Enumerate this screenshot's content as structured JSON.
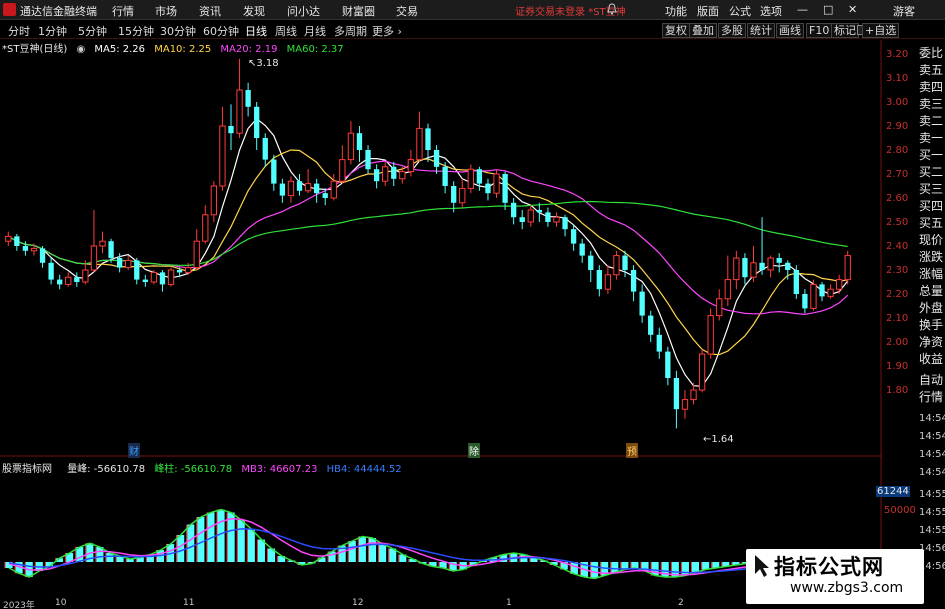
{
  "app": {
    "title": "通达信金融终端",
    "menu": [
      "行情",
      "市场",
      "资讯",
      "发现",
      "问小达",
      "财富圈",
      "交易"
    ],
    "warning": "证券交易未登录",
    "stock_tag": "*ST豆神",
    "links": [
      "功能",
      "版面",
      "公式",
      "选项"
    ],
    "guest": "游客"
  },
  "periods": [
    "分时",
    "1分钟",
    "5分钟",
    "15分钟",
    "30分钟",
    "60分钟",
    "日线",
    "周线",
    "月线",
    "多周期",
    "更多"
  ],
  "active_period": "日线",
  "toolbar_right": [
    "复权",
    "叠加",
    "多股",
    "统计",
    "画线",
    "F10",
    "标记",
    "+自选"
  ],
  "main_legend": {
    "name": "*ST豆神(日线)",
    "ma5": "MA5: 2.26",
    "ma10": "MA10: 2.25",
    "ma20": "MA20: 2.19",
    "ma60": "MA60: 2.37"
  },
  "annotations": {
    "high": "3.18",
    "low": "1.64"
  },
  "event_marks": [
    "财",
    "除",
    "预"
  ],
  "sub_legend": {
    "name": "股票指标网",
    "vol": "量峰: -56610.78",
    "bar": "峰柱: -56610.78",
    "mb3": "MB3: 46607.23",
    "hb4": "HB4: 44444.52"
  },
  "y_axis": [
    "3.20",
    "3.10",
    "3.00",
    "2.90",
    "2.80",
    "2.70",
    "2.60",
    "2.50",
    "2.40",
    "2.30",
    "2.20",
    "2.10",
    "2.00",
    "1.90",
    "1.80"
  ],
  "sub_axis": {
    "value": "61244",
    "mid": "50000"
  },
  "times": [
    "14:54",
    "14:54",
    "14:54",
    "14:54",
    "14:55",
    "14:55",
    "14:55",
    "14:56",
    "14:56"
  ],
  "right_panel": [
    "委比",
    "卖五",
    "卖四",
    "卖三",
    "卖二",
    "卖一",
    "买一",
    "买二",
    "买三",
    "买四",
    "买五",
    "现价",
    "涨跌",
    "涨幅",
    "总量",
    "外盘",
    "换手",
    "净资",
    "收益",
    "自动",
    "行情"
  ],
  "x_axis": [
    "2023年",
    "10",
    "11",
    "12",
    "1",
    "2"
  ],
  "watermark": {
    "title": "指标公式网",
    "url": "www.zbgs3.com"
  },
  "colors": {
    "up": "#ff3b3b",
    "down": "#54ffff",
    "ma5": "#ffffff",
    "ma10": "#ffd54a",
    "ma20": "#ff46ff",
    "ma60": "#2fe23a",
    "axis": "#c83030"
  },
  "chart_data": {
    "type": "candlestick",
    "ylim": [
      1.64,
      3.22
    ],
    "candles": [
      {
        "o": 2.42,
        "c": 2.44,
        "h": 2.46,
        "l": 2.4
      },
      {
        "o": 2.44,
        "c": 2.4,
        "h": 2.45,
        "l": 2.38
      },
      {
        "o": 2.4,
        "c": 2.38,
        "h": 2.42,
        "l": 2.36
      },
      {
        "o": 2.38,
        "c": 2.39,
        "h": 2.41,
        "l": 2.36
      },
      {
        "o": 2.39,
        "c": 2.33,
        "h": 2.4,
        "l": 2.31
      },
      {
        "o": 2.33,
        "c": 2.26,
        "h": 2.35,
        "l": 2.24
      },
      {
        "o": 2.26,
        "c": 2.24,
        "h": 2.28,
        "l": 2.22
      },
      {
        "o": 2.24,
        "c": 2.27,
        "h": 2.29,
        "l": 2.23
      },
      {
        "o": 2.27,
        "c": 2.25,
        "h": 2.29,
        "l": 2.23
      },
      {
        "o": 2.25,
        "c": 2.3,
        "h": 2.34,
        "l": 2.24
      },
      {
        "o": 2.3,
        "c": 2.4,
        "h": 2.55,
        "l": 2.29
      },
      {
        "o": 2.4,
        "c": 2.42,
        "h": 2.46,
        "l": 2.37
      },
      {
        "o": 2.42,
        "c": 2.35,
        "h": 2.43,
        "l": 2.33
      },
      {
        "o": 2.35,
        "c": 2.31,
        "h": 2.37,
        "l": 2.29
      },
      {
        "o": 2.31,
        "c": 2.34,
        "h": 2.36,
        "l": 2.3
      },
      {
        "o": 2.34,
        "c": 2.26,
        "h": 2.35,
        "l": 2.24
      },
      {
        "o": 2.26,
        "c": 2.25,
        "h": 2.28,
        "l": 2.23
      },
      {
        "o": 2.25,
        "c": 2.29,
        "h": 2.3,
        "l": 2.24
      },
      {
        "o": 2.29,
        "c": 2.24,
        "h": 2.3,
        "l": 2.21
      },
      {
        "o": 2.24,
        "c": 2.3,
        "h": 2.31,
        "l": 2.23
      },
      {
        "o": 2.3,
        "c": 2.29,
        "h": 2.31,
        "l": 2.27
      },
      {
        "o": 2.29,
        "c": 2.31,
        "h": 2.33,
        "l": 2.28
      },
      {
        "o": 2.31,
        "c": 2.42,
        "h": 2.47,
        "l": 2.3
      },
      {
        "o": 2.42,
        "c": 2.53,
        "h": 2.57,
        "l": 2.41
      },
      {
        "o": 2.53,
        "c": 2.65,
        "h": 2.67,
        "l": 2.5
      },
      {
        "o": 2.65,
        "c": 2.9,
        "h": 2.98,
        "l": 2.63
      },
      {
        "o": 2.9,
        "c": 2.87,
        "h": 2.99,
        "l": 2.8
      },
      {
        "o": 2.87,
        "c": 3.05,
        "h": 3.18,
        "l": 2.85
      },
      {
        "o": 3.05,
        "c": 2.98,
        "h": 3.08,
        "l": 2.94
      },
      {
        "o": 2.98,
        "c": 2.85,
        "h": 3.0,
        "l": 2.8
      },
      {
        "o": 2.85,
        "c": 2.76,
        "h": 2.87,
        "l": 2.73
      },
      {
        "o": 2.76,
        "c": 2.66,
        "h": 2.78,
        "l": 2.63
      },
      {
        "o": 2.66,
        "c": 2.61,
        "h": 2.68,
        "l": 2.58
      },
      {
        "o": 2.61,
        "c": 2.67,
        "h": 2.69,
        "l": 2.58
      },
      {
        "o": 2.67,
        "c": 2.63,
        "h": 2.7,
        "l": 2.61
      },
      {
        "o": 2.63,
        "c": 2.66,
        "h": 2.72,
        "l": 2.62
      },
      {
        "o": 2.66,
        "c": 2.62,
        "h": 2.68,
        "l": 2.58
      },
      {
        "o": 2.62,
        "c": 2.6,
        "h": 2.64,
        "l": 2.57
      },
      {
        "o": 2.6,
        "c": 2.67,
        "h": 2.7,
        "l": 2.59
      },
      {
        "o": 2.67,
        "c": 2.76,
        "h": 2.82,
        "l": 2.66
      },
      {
        "o": 2.76,
        "c": 2.87,
        "h": 2.92,
        "l": 2.74
      },
      {
        "o": 2.87,
        "c": 2.8,
        "h": 2.9,
        "l": 2.75
      },
      {
        "o": 2.8,
        "c": 2.72,
        "h": 2.82,
        "l": 2.7
      },
      {
        "o": 2.72,
        "c": 2.67,
        "h": 2.74,
        "l": 2.64
      },
      {
        "o": 2.67,
        "c": 2.73,
        "h": 2.75,
        "l": 2.65
      },
      {
        "o": 2.73,
        "c": 2.68,
        "h": 2.75,
        "l": 2.65
      },
      {
        "o": 2.68,
        "c": 2.71,
        "h": 2.73,
        "l": 2.66
      },
      {
        "o": 2.71,
        "c": 2.76,
        "h": 2.8,
        "l": 2.69
      },
      {
        "o": 2.76,
        "c": 2.89,
        "h": 2.96,
        "l": 2.75
      },
      {
        "o": 2.89,
        "c": 2.8,
        "h": 2.91,
        "l": 2.75
      },
      {
        "o": 2.8,
        "c": 2.73,
        "h": 2.82,
        "l": 2.7
      },
      {
        "o": 2.73,
        "c": 2.65,
        "h": 2.75,
        "l": 2.62
      },
      {
        "o": 2.65,
        "c": 2.58,
        "h": 2.67,
        "l": 2.54
      },
      {
        "o": 2.58,
        "c": 2.64,
        "h": 2.68,
        "l": 2.56
      },
      {
        "o": 2.64,
        "c": 2.72,
        "h": 2.74,
        "l": 2.62
      },
      {
        "o": 2.72,
        "c": 2.66,
        "h": 2.73,
        "l": 2.63
      },
      {
        "o": 2.66,
        "c": 2.62,
        "h": 2.68,
        "l": 2.59
      },
      {
        "o": 2.62,
        "c": 2.7,
        "h": 2.72,
        "l": 2.6
      },
      {
        "o": 2.7,
        "c": 2.58,
        "h": 2.71,
        "l": 2.55
      },
      {
        "o": 2.58,
        "c": 2.52,
        "h": 2.6,
        "l": 2.49
      },
      {
        "o": 2.52,
        "c": 2.5,
        "h": 2.55,
        "l": 2.47
      },
      {
        "o": 2.5,
        "c": 2.55,
        "h": 2.57,
        "l": 2.48
      },
      {
        "o": 2.55,
        "c": 2.54,
        "h": 2.58,
        "l": 2.5
      },
      {
        "o": 2.54,
        "c": 2.5,
        "h": 2.56,
        "l": 2.48
      },
      {
        "o": 2.5,
        "c": 2.52,
        "h": 2.54,
        "l": 2.48
      },
      {
        "o": 2.52,
        "c": 2.47,
        "h": 2.53,
        "l": 2.44
      },
      {
        "o": 2.47,
        "c": 2.41,
        "h": 2.49,
        "l": 2.38
      },
      {
        "o": 2.41,
        "c": 2.36,
        "h": 2.43,
        "l": 2.33
      },
      {
        "o": 2.36,
        "c": 2.3,
        "h": 2.38,
        "l": 2.25
      },
      {
        "o": 2.3,
        "c": 2.22,
        "h": 2.32,
        "l": 2.19
      },
      {
        "o": 2.22,
        "c": 2.28,
        "h": 2.32,
        "l": 2.2
      },
      {
        "o": 2.28,
        "c": 2.36,
        "h": 2.38,
        "l": 2.26
      },
      {
        "o": 2.36,
        "c": 2.3,
        "h": 2.38,
        "l": 2.27
      },
      {
        "o": 2.3,
        "c": 2.21,
        "h": 2.32,
        "l": 2.17
      },
      {
        "o": 2.21,
        "c": 2.11,
        "h": 2.24,
        "l": 2.08
      },
      {
        "o": 2.11,
        "c": 2.03,
        "h": 2.13,
        "l": 2.0
      },
      {
        "o": 2.03,
        "c": 1.96,
        "h": 2.06,
        "l": 1.93
      },
      {
        "o": 1.96,
        "c": 1.85,
        "h": 1.98,
        "l": 1.82
      },
      {
        "o": 1.85,
        "c": 1.72,
        "h": 1.88,
        "l": 1.64
      },
      {
        "o": 1.72,
        "c": 1.76,
        "h": 1.8,
        "l": 1.68
      },
      {
        "o": 1.76,
        "c": 1.8,
        "h": 1.83,
        "l": 1.74
      },
      {
        "o": 1.8,
        "c": 1.95,
        "h": 1.97,
        "l": 1.79
      },
      {
        "o": 1.95,
        "c": 2.11,
        "h": 2.14,
        "l": 1.93
      },
      {
        "o": 2.11,
        "c": 2.18,
        "h": 2.22,
        "l": 2.09
      },
      {
        "o": 2.18,
        "c": 2.26,
        "h": 2.36,
        "l": 2.15
      },
      {
        "o": 2.26,
        "c": 2.35,
        "h": 2.38,
        "l": 2.22
      },
      {
        "o": 2.35,
        "c": 2.27,
        "h": 2.37,
        "l": 2.24
      },
      {
        "o": 2.27,
        "c": 2.33,
        "h": 2.4,
        "l": 2.25
      },
      {
        "o": 2.33,
        "c": 2.3,
        "h": 2.52,
        "l": 2.28
      },
      {
        "o": 2.3,
        "c": 2.35,
        "h": 2.36,
        "l": 2.27
      },
      {
        "o": 2.35,
        "c": 2.33,
        "h": 2.37,
        "l": 2.29
      },
      {
        "o": 2.33,
        "c": 2.3,
        "h": 2.34,
        "l": 2.26
      },
      {
        "o": 2.3,
        "c": 2.2,
        "h": 2.32,
        "l": 2.18
      },
      {
        "o": 2.2,
        "c": 2.14,
        "h": 2.22,
        "l": 2.12
      },
      {
        "o": 2.14,
        "c": 2.24,
        "h": 2.26,
        "l": 2.13
      },
      {
        "o": 2.24,
        "c": 2.19,
        "h": 2.25,
        "l": 2.17
      },
      {
        "o": 2.19,
        "c": 2.22,
        "h": 2.24,
        "l": 2.18
      },
      {
        "o": 2.22,
        "c": 2.26,
        "h": 2.28,
        "l": 2.2
      },
      {
        "o": 2.26,
        "c": 2.36,
        "h": 2.38,
        "l": 2.24
      }
    ],
    "ma_series": [
      {
        "name": "MA5",
        "period": 5
      },
      {
        "name": "MA10",
        "period": 10
      },
      {
        "name": "MA20",
        "period": 20
      },
      {
        "name": "MA60",
        "period": 60
      }
    ],
    "sub_chart": {
      "bars": [
        -8,
        -15,
        -20,
        -12,
        -6,
        5,
        12,
        20,
        25,
        20,
        12,
        8,
        4,
        6,
        10,
        16,
        24,
        36,
        50,
        60,
        66,
        70,
        66,
        56,
        44,
        30,
        18,
        8,
        2,
        -4,
        -2,
        6,
        14,
        22,
        28,
        34,
        32,
        24,
        18,
        10,
        4,
        -2,
        -6,
        -8,
        -12,
        -10,
        -4,
        2,
        6,
        10,
        12,
        10,
        6,
        2,
        -4,
        -10,
        -16,
        -20,
        -22,
        -18,
        -14,
        -10,
        -8,
        -12,
        -18,
        -20,
        -20,
        -18,
        -14,
        -10,
        -8,
        -6,
        -4,
        -2,
        2,
        6,
        10,
        14,
        16,
        12,
        8,
        4,
        2,
        0
      ]
    }
  }
}
